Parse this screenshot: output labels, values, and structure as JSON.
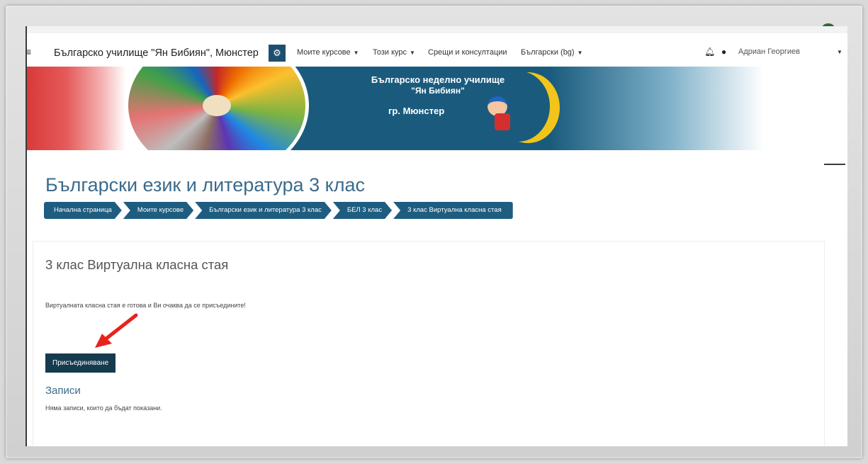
{
  "navbar": {
    "site_name": "Българско училище \"Ян Бибиян\", Мюнстер",
    "items": [
      {
        "label": "Моите курсове"
      },
      {
        "label": "Този курс"
      },
      {
        "label": "Срещи и консултации"
      },
      {
        "label": "Български (bg)"
      }
    ],
    "user_name": "Адриан Георгиев"
  },
  "banner": {
    "line1": "Българско неделно училище",
    "line2": "\"Ян Бибиян\"",
    "line3": "гр. Мюнстер"
  },
  "page_title": "Български език и литература 3 клас",
  "breadcrumb": [
    "Начална страница",
    "Моите курсове",
    "Български език и литература 3 клас",
    "БЕЛ 3 клас",
    "3 клас Виртуална класна стая"
  ],
  "activity": {
    "title": "3 клас Виртуална класна стая",
    "description": "Виртуалната класна стая е готова и Ви очаква да се присъедините!",
    "join_label": "Присъединяване"
  },
  "recordings": {
    "title": "Записи",
    "empty_text": "Няма записи, които да бъдат показани."
  },
  "icons": {
    "menu": "hamburger-menu-icon",
    "settings": "gear-icon",
    "notifications": "bell-icon",
    "messages": "chat-bubble-icon",
    "annotation": "red-arrow-icon"
  },
  "colors": {
    "navy": "#1e4e6f",
    "breadcrumb": "#1e5d80",
    "button": "#163a4e",
    "title": "#3b6b8c",
    "arrow": "#e8221b"
  }
}
